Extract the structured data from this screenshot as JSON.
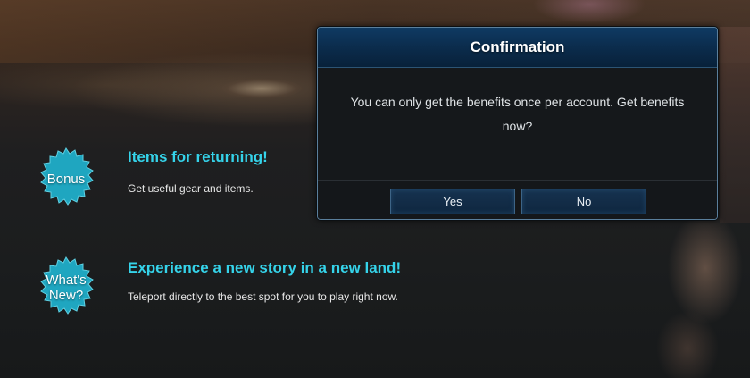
{
  "features": [
    {
      "badge": "Bonus",
      "title": "Items for returning!",
      "description": "Get useful gear and items."
    },
    {
      "badge_line1": "What's",
      "badge_line2": "New?",
      "title": "Experience a new story in a new land!",
      "description": "Teleport directly to the best spot for you to play right now."
    }
  ],
  "dialog": {
    "title": "Confirmation",
    "message": "You can only get the benefits once per account. Get benefits now?",
    "yes_label": "Yes",
    "no_label": "No"
  },
  "colors": {
    "accent_cyan": "#35d3ea",
    "badge_teal": "#22a9c3",
    "dialog_header": "#0b2c4c"
  }
}
